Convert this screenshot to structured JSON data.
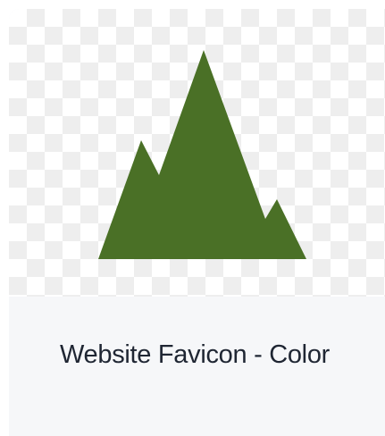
{
  "asset": {
    "title": "Website Favicon - Color",
    "thumbnail_icon": "mountain-icon",
    "icon_color": "#4a7026"
  }
}
